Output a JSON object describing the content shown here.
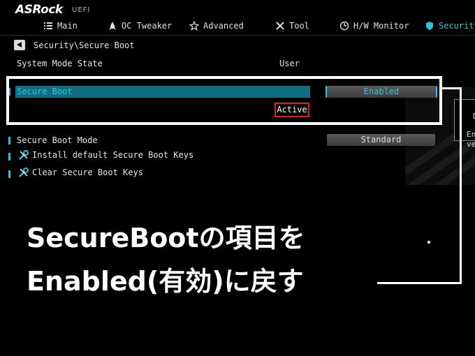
{
  "brand": {
    "name": "ASRock",
    "sub": "UEFI"
  },
  "nav": [
    {
      "label": "Main",
      "icon": "main-list-icon",
      "active": false
    },
    {
      "label": "OC Tweaker",
      "icon": "rocket-icon",
      "active": false
    },
    {
      "label": "Advanced",
      "icon": "star-icon",
      "active": false
    },
    {
      "label": "Tool",
      "icon": "tools-icon",
      "active": false
    },
    {
      "label": "H/W Monitor",
      "icon": "gauge-icon",
      "active": false
    },
    {
      "label": "Security",
      "icon": "shield-icon",
      "active": true
    }
  ],
  "breadcrumb": "Security\\Secure Boot",
  "system_mode": {
    "label": "System Mode State",
    "value": "User"
  },
  "secure_boot": {
    "label": "Secure Boot",
    "value": "Enabled",
    "status": "Active"
  },
  "secure_boot_mode": {
    "label": "Secure Boot Mode",
    "value": "Standard"
  },
  "actions": [
    {
      "label": "Install default Secure Boot Keys",
      "icon": "wrench-icon"
    },
    {
      "label": "Clear Secure Boot Keys",
      "icon": "wrench-icon"
    }
  ],
  "right_panel_text": {
    "line1": "En",
    "line2": "ve",
    "letter": "D"
  },
  "overlay": {
    "line1": "SecureBootの項目を",
    "line2": "Enabled(有効)に戻す"
  },
  "colors": {
    "accent": "#2ec3e6",
    "selected_bg": "#11707f",
    "highlight_border": "#e02020"
  }
}
